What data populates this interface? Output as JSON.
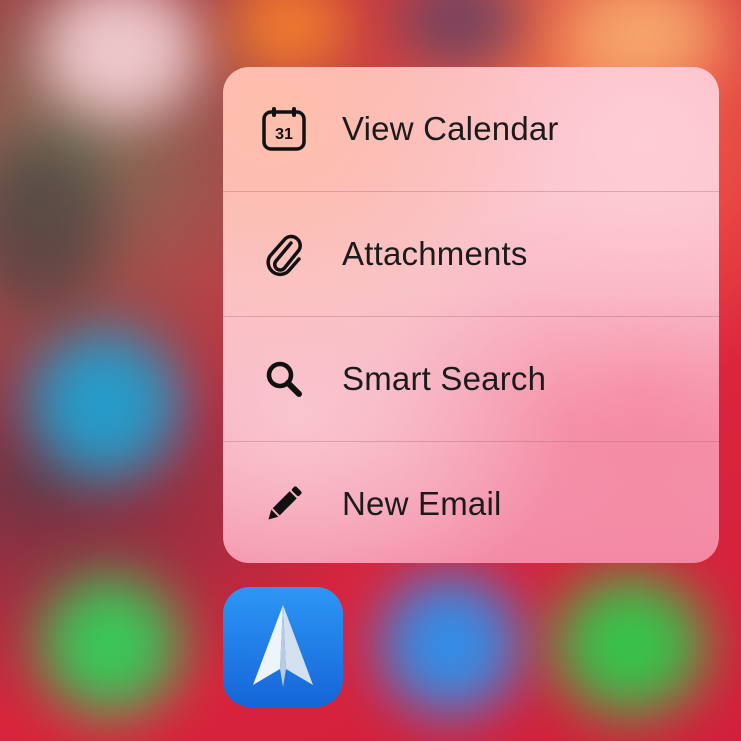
{
  "quick_actions": {
    "items": [
      {
        "label": "View Calendar",
        "icon": "calendar-icon",
        "icon_text": "31"
      },
      {
        "label": "Attachments",
        "icon": "paperclip-icon"
      },
      {
        "label": "Smart Search",
        "icon": "search-icon"
      },
      {
        "label": "New Email",
        "icon": "pencil-icon"
      }
    ]
  },
  "app": {
    "icon": "paper-plane-icon",
    "icon_color": "#1a7ae6"
  }
}
